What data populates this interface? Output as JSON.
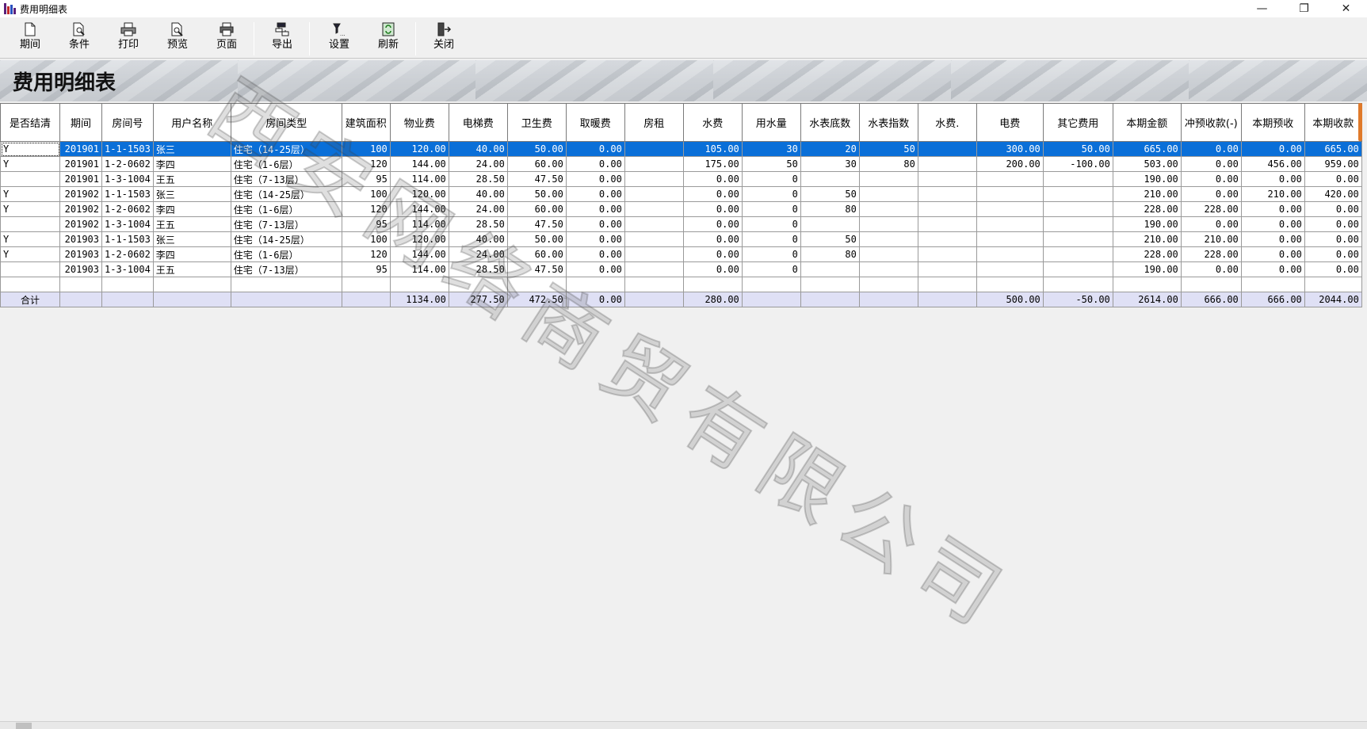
{
  "window": {
    "title": "费用明细表",
    "controls": [
      "minimize-icon",
      "restore-icon",
      "close-icon"
    ]
  },
  "toolbar": {
    "buttons": [
      {
        "label": "期间",
        "icon": "new-doc-icon"
      },
      {
        "label": "条件",
        "icon": "search-doc-icon"
      },
      {
        "label": "打印",
        "icon": "printer-icon"
      },
      {
        "label": "预览",
        "icon": "preview-icon"
      },
      {
        "label": "页面",
        "icon": "page-setup-icon"
      },
      {
        "label": "导出",
        "icon": "export-icon"
      },
      {
        "label": "设置",
        "icon": "settings-icon"
      },
      {
        "label": "刷新",
        "icon": "refresh-icon"
      },
      {
        "label": "关闭",
        "icon": "exit-icon"
      }
    ]
  },
  "banner": {
    "title": "费用明细表"
  },
  "watermark": "西安网络商贸有限公司",
  "grid": {
    "columns": [
      "是否结清",
      "期间",
      "房间号",
      "用户名称",
      "房间类型",
      "建筑面积",
      "物业费",
      "电梯费",
      "卫生费",
      "取暖费",
      "房租",
      "水费",
      "用水量",
      "水表底数",
      "水表指数",
      "水费.",
      "电费",
      "其它费用",
      "本期金额",
      "冲预收款(-)",
      "本期预收",
      "本期收款"
    ],
    "rows": [
      [
        "Y",
        "201901",
        "1-1-1503",
        "张三",
        "住宅（14-25层）",
        "100",
        "120.00",
        "40.00",
        "50.00",
        "0.00",
        "",
        "105.00",
        "30",
        "20",
        "50",
        "",
        "300.00",
        "50.00",
        "665.00",
        "0.00",
        "0.00",
        "665.00"
      ],
      [
        "Y",
        "201901",
        "1-2-0602",
        "李四",
        "住宅（1-6层）",
        "120",
        "144.00",
        "24.00",
        "60.00",
        "0.00",
        "",
        "175.00",
        "50",
        "30",
        "80",
        "",
        "200.00",
        "-100.00",
        "503.00",
        "0.00",
        "456.00",
        "959.00"
      ],
      [
        "",
        "201901",
        "1-3-1004",
        "王五",
        "住宅（7-13层）",
        "95",
        "114.00",
        "28.50",
        "47.50",
        "0.00",
        "",
        "0.00",
        "0",
        "",
        "",
        "",
        "",
        "",
        "190.00",
        "0.00",
        "0.00",
        "0.00"
      ],
      [
        "Y",
        "201902",
        "1-1-1503",
        "张三",
        "住宅（14-25层）",
        "100",
        "120.00",
        "40.00",
        "50.00",
        "0.00",
        "",
        "0.00",
        "0",
        "50",
        "",
        "",
        "",
        "",
        "210.00",
        "0.00",
        "210.00",
        "420.00"
      ],
      [
        "Y",
        "201902",
        "1-2-0602",
        "李四",
        "住宅（1-6层）",
        "120",
        "144.00",
        "24.00",
        "60.00",
        "0.00",
        "",
        "0.00",
        "0",
        "80",
        "",
        "",
        "",
        "",
        "228.00",
        "228.00",
        "0.00",
        "0.00"
      ],
      [
        "",
        "201902",
        "1-3-1004",
        "王五",
        "住宅（7-13层）",
        "95",
        "114.00",
        "28.50",
        "47.50",
        "0.00",
        "",
        "0.00",
        "0",
        "",
        "",
        "",
        "",
        "",
        "190.00",
        "0.00",
        "0.00",
        "0.00"
      ],
      [
        "Y",
        "201903",
        "1-1-1503",
        "张三",
        "住宅（14-25层）",
        "100",
        "120.00",
        "40.00",
        "50.00",
        "0.00",
        "",
        "0.00",
        "0",
        "50",
        "",
        "",
        "",
        "",
        "210.00",
        "210.00",
        "0.00",
        "0.00"
      ],
      [
        "Y",
        "201903",
        "1-2-0602",
        "李四",
        "住宅（1-6层）",
        "120",
        "144.00",
        "24.00",
        "60.00",
        "0.00",
        "",
        "0.00",
        "0",
        "80",
        "",
        "",
        "",
        "",
        "228.00",
        "228.00",
        "0.00",
        "0.00"
      ],
      [
        "",
        "201903",
        "1-3-1004",
        "王五",
        "住宅（7-13层）",
        "95",
        "114.00",
        "28.50",
        "47.50",
        "0.00",
        "",
        "0.00",
        "0",
        "",
        "",
        "",
        "",
        "",
        "190.00",
        "0.00",
        "0.00",
        "0.00"
      ],
      [
        "",
        "",
        "",
        "",
        "",
        "",
        "",
        "",
        "",
        "",
        "",
        "",
        "",
        "",
        "",
        "",
        "",
        "",
        "",
        "",
        "",
        ""
      ]
    ],
    "total": [
      "合计",
      "",
      "",
      "",
      "",
      "",
      "1134.00",
      "277.50",
      "472.50",
      "0.00",
      "",
      "280.00",
      "",
      "",
      "",
      "",
      "500.00",
      "-50.00",
      "2614.00",
      "666.00",
      "666.00",
      "2044.00"
    ],
    "selected_row": 0
  },
  "colors": {
    "selection": "#0a6fd8",
    "total_row": "#dfe0f5",
    "window_bg": "#f0f0f0"
  }
}
